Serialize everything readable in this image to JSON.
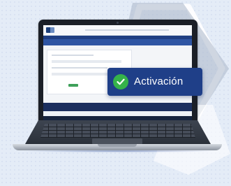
{
  "badge": {
    "label": "Activación",
    "icon": "check-circle-icon",
    "background": "#1f3f88",
    "icon_color": "#35b34a"
  },
  "colors": {
    "background": "#e4ecf7",
    "hexagon": "#a9b7c9",
    "laptop_body": "#2b313a"
  }
}
